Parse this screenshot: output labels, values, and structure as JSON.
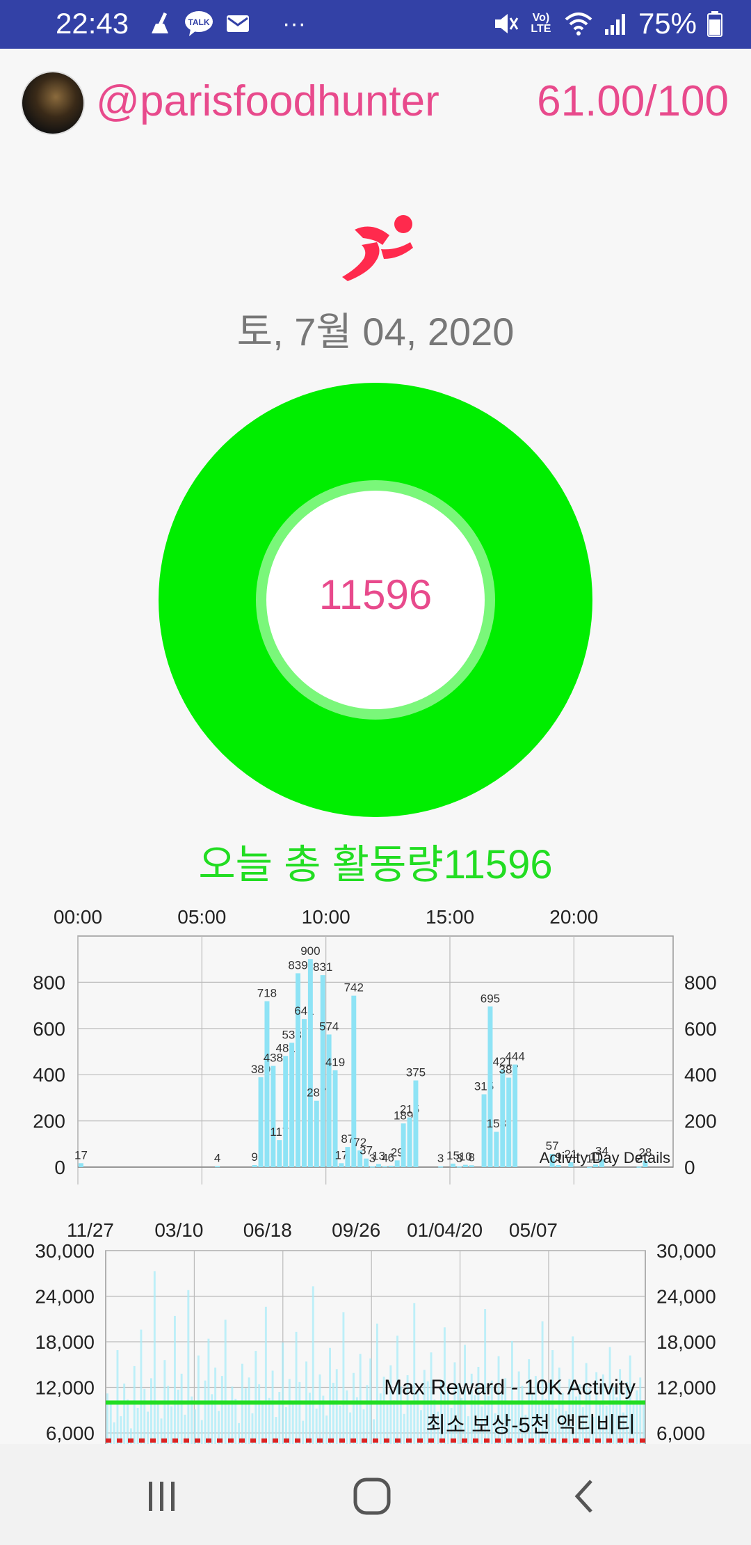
{
  "status_bar": {
    "time": "22:43",
    "talk_badge": "TALK",
    "more": "···",
    "volte": "Vo) LTE",
    "battery": "75%",
    "icons": [
      "cleaner-icon",
      "talk-icon",
      "mail-icon",
      "mute-icon",
      "volte-icon",
      "wifi-icon",
      "signal-icon",
      "battery-icon"
    ]
  },
  "header": {
    "username": "@parisfoodhunter",
    "score": "61.00/100"
  },
  "date_label": "토, 7월 04, 2020",
  "activity_value": "11596",
  "total_label": "오늘 총 활동량11596",
  "colors": {
    "accent": "#e84a8c",
    "ring": "#00ee00",
    "ring_inner": "#7af77a",
    "bar": "#8ee3f5",
    "status_bar": "#3341a6"
  },
  "chart_data": [
    {
      "type": "bar",
      "title": "",
      "caption": "Activity Day Details",
      "xlabel": "",
      "ylabel": "",
      "x_ticks": [
        "00:00",
        "05:00",
        "10:00",
        "15:00",
        "20:00"
      ],
      "x_range_hours": [
        0,
        24
      ],
      "ylim": [
        0,
        1000
      ],
      "y_ticks": [
        "0",
        "200",
        "400",
        "600",
        "800"
      ],
      "grid": true,
      "points": [
        {
          "h": 0.0,
          "v": 17,
          "label": "17"
        },
        {
          "h": 5.5,
          "v": 4,
          "label": "4"
        },
        {
          "h": 7.0,
          "v": 9,
          "label": "9"
        },
        {
          "h": 7.25,
          "v": 389,
          "label": "389"
        },
        {
          "h": 7.5,
          "v": 718,
          "label": "718"
        },
        {
          "h": 7.75,
          "v": 438,
          "label": "438"
        },
        {
          "h": 8.0,
          "v": 117,
          "label": "117"
        },
        {
          "h": 8.25,
          "v": 481,
          "label": "481"
        },
        {
          "h": 8.5,
          "v": 538,
          "label": "538"
        },
        {
          "h": 8.75,
          "v": 839,
          "label": "839"
        },
        {
          "h": 9.0,
          "v": 641,
          "label": "641"
        },
        {
          "h": 9.25,
          "v": 900,
          "label": "900"
        },
        {
          "h": 9.5,
          "v": 287,
          "label": "287"
        },
        {
          "h": 9.75,
          "v": 831,
          "label": "831"
        },
        {
          "h": 10.0,
          "v": 574,
          "label": "574"
        },
        {
          "h": 10.25,
          "v": 419,
          "label": "419"
        },
        {
          "h": 10.5,
          "v": 17,
          "label": "17"
        },
        {
          "h": 10.75,
          "v": 87,
          "label": "87"
        },
        {
          "h": 11.0,
          "v": 742,
          "label": "742"
        },
        {
          "h": 11.25,
          "v": 72,
          "label": "72"
        },
        {
          "h": 11.5,
          "v": 37,
          "label": "37"
        },
        {
          "h": 11.75,
          "v": 3,
          "label": "3"
        },
        {
          "h": 12.0,
          "v": 13,
          "label": "13"
        },
        {
          "h": 12.25,
          "v": 4,
          "label": "4"
        },
        {
          "h": 12.5,
          "v": 6,
          "label": "6"
        },
        {
          "h": 12.75,
          "v": 29,
          "label": "29"
        },
        {
          "h": 13.0,
          "v": 189,
          "label": "189"
        },
        {
          "h": 13.25,
          "v": 215,
          "label": "215"
        },
        {
          "h": 13.5,
          "v": 375,
          "label": "375"
        },
        {
          "h": 14.5,
          "v": 3,
          "label": "3"
        },
        {
          "h": 15.0,
          "v": 15,
          "label": "15"
        },
        {
          "h": 15.25,
          "v": 3,
          "label": "3"
        },
        {
          "h": 15.5,
          "v": 10,
          "label": "10"
        },
        {
          "h": 15.75,
          "v": 8,
          "label": "8"
        },
        {
          "h": 16.25,
          "v": 315,
          "label": "315"
        },
        {
          "h": 16.5,
          "v": 695,
          "label": "695"
        },
        {
          "h": 16.75,
          "v": 153,
          "label": "153"
        },
        {
          "h": 17.0,
          "v": 421,
          "label": "421"
        },
        {
          "h": 17.25,
          "v": 387,
          "label": "387"
        },
        {
          "h": 17.5,
          "v": 444,
          "label": "444"
        },
        {
          "h": 19.0,
          "v": 57,
          "label": "57"
        },
        {
          "h": 19.25,
          "v": 9,
          "label": "9"
        },
        {
          "h": 19.75,
          "v": 21,
          "label": "21"
        },
        {
          "h": 20.5,
          "v": 1,
          "label": "1"
        },
        {
          "h": 20.75,
          "v": 11,
          "label": "11"
        },
        {
          "h": 21.0,
          "v": 34,
          "label": "34"
        },
        {
          "h": 22.5,
          "v": 2,
          "label": "2"
        },
        {
          "h": 22.75,
          "v": 28,
          "label": "28"
        }
      ]
    },
    {
      "type": "bar",
      "title": "",
      "xlabel": "",
      "ylabel": "",
      "x_ticks": [
        "11/27",
        "03/10",
        "06/18",
        "09/26",
        "01/04/20",
        "05/07"
      ],
      "ylim": [
        3000,
        30000
      ],
      "y_ticks": [
        "30,000",
        "24,000",
        "18,000",
        "12,000",
        "6,000"
      ],
      "grid": true,
      "reference_lines": [
        {
          "label": "Max Reward - 10K Activity",
          "value": 10000,
          "color": "#22dd22",
          "style": "solid"
        },
        {
          "label": "최소 보상-5천 액티비티",
          "value": 5000,
          "color": "#dd2222",
          "style": "dotted"
        }
      ],
      "values": [
        11200,
        9800,
        7400,
        16900,
        8200,
        12500,
        10400,
        6600,
        14800,
        9300,
        19600,
        11800,
        8800,
        13200,
        27300,
        10100,
        7900,
        15600,
        12200,
        9500,
        21400,
        11700,
        13800,
        8400,
        24800,
        10800,
        9100,
        16200,
        7700,
        12900,
        18400,
        11100,
        14600,
        8900,
        13500,
        20900,
        9700,
        12100,
        10500,
        7300,
        15100,
        11900,
        13300,
        8600,
        16800,
        12400,
        9900,
        22600,
        10600,
        14200,
        8100,
        11400,
        17900,
        9400,
        13100,
        10200,
        19300,
        12700,
        7600,
        15400,
        11300,
        25300,
        9200,
        13700,
        10900,
        8300,
        17200,
        12600,
        14400,
        9600,
        21900,
        11600,
        8700,
        13900,
        10700,
        16400,
        9100,
        12300,
        15800,
        7800,
        20400,
        11200,
        13400,
        9800,
        14900,
        10300,
        18800,
        12100,
        8500,
        13600,
        10100,
        23100,
        11500,
        9000,
        14300,
        12800,
        16600,
        10400,
        8800,
        13000,
        19900,
        11800,
        9300,
        15300,
        12500,
        10600,
        17600,
        8200,
        13800,
        11000,
        14700,
        9500,
        22300,
        10900,
        12900,
        8600,
        16100,
        11400,
        13200,
        10000,
        18100,
        9700,
        14100,
        12200,
        8400,
        15700,
        11100,
        13500,
        9900,
        20700,
        10500,
        12600,
        16900,
        9200,
        14600,
        11300,
        8900,
        13100,
        18700,
        10800,
        12400,
        9400,
        15200,
        11900,
        8100,
        14000,
        10200,
        13700,
        9600,
        17300,
        12000,
        10700,
        14400,
        8700,
        12700,
        16200,
        9800,
        11600,
        13300,
        10300
      ]
    }
  ],
  "nav": {
    "icons": [
      "recent-apps-icon",
      "home-icon",
      "back-icon"
    ]
  }
}
